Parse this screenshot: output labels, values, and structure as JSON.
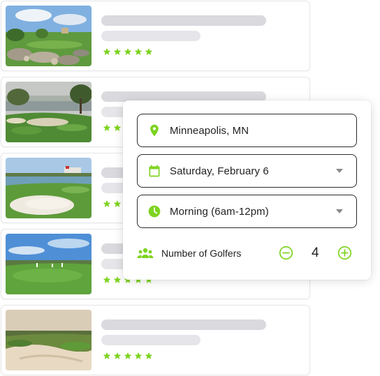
{
  "colors": {
    "accent": "#7ed321",
    "bar_dark": "#d9d9de",
    "bar_light": "#e6e6ea",
    "border": "#2b2b2b"
  },
  "courses": [
    {
      "thumb": "course-photo-1",
      "rating": 5
    },
    {
      "thumb": "course-photo-2",
      "rating": 5
    },
    {
      "thumb": "course-photo-3",
      "rating": 5
    },
    {
      "thumb": "course-photo-4",
      "rating": 5
    },
    {
      "thumb": "course-photo-5",
      "rating": 5
    }
  ],
  "search": {
    "location": {
      "icon": "map-pin-icon",
      "value": "Minneapolis, MN"
    },
    "date": {
      "icon": "calendar-icon",
      "value": "Saturday, February 6",
      "dropdown_icon": "chevron-down-icon"
    },
    "time": {
      "icon": "clock-icon",
      "value": "Morning (6am-12pm)",
      "dropdown_icon": "chevron-down-icon"
    },
    "golfers": {
      "icon": "group-icon",
      "label": "Number of Golfers",
      "count": "4",
      "decrement_icon": "minus-circle-icon",
      "increment_icon": "plus-circle-icon"
    }
  }
}
